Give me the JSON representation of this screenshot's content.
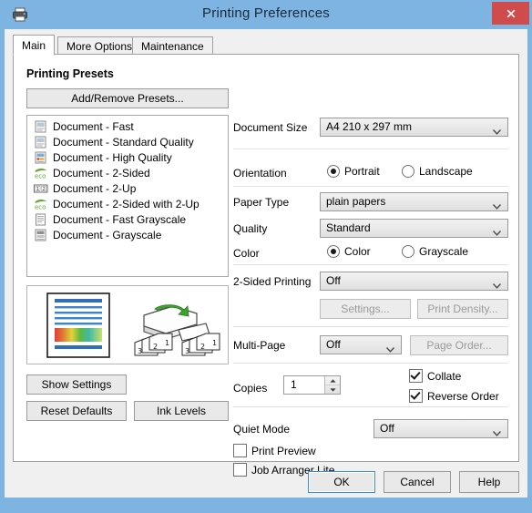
{
  "window": {
    "title": "Printing Preferences",
    "title_icon": "printer-icon",
    "close_label": "✕",
    "titlebar_color": "#7eb4e2",
    "close_color": "#d04c4c"
  },
  "tabs": [
    {
      "label": "Main",
      "active": true
    },
    {
      "label": "More Options",
      "active": false
    },
    {
      "label": "Maintenance",
      "active": false
    }
  ],
  "presets": {
    "heading": "Printing Presets",
    "add_remove_label": "Add/Remove Presets...",
    "items": [
      {
        "label": "Document - Fast",
        "icon": "document-icon"
      },
      {
        "label": "Document - Standard Quality",
        "icon": "document-icon"
      },
      {
        "label": "Document - High Quality",
        "icon": "document-color-icon"
      },
      {
        "label": "Document - 2-Sided",
        "icon": "eco-icon"
      },
      {
        "label": "Document - 2-Up",
        "icon": "two-up-icon"
      },
      {
        "label": "Document - 2-Sided with 2-Up",
        "icon": "eco-icon"
      },
      {
        "label": "Document - Fast Grayscale",
        "icon": "document-gray-icon"
      },
      {
        "label": "Document - Grayscale",
        "icon": "document-gray-dark-icon"
      }
    ]
  },
  "preview": {
    "page_icon": "page-preview-icon",
    "printer_icon": "printer-duplex-icon",
    "stack_labels": [
      "3",
      "2",
      "1"
    ]
  },
  "left_buttons": {
    "show_settings": "Show Settings",
    "reset_defaults": "Reset Defaults",
    "ink_levels": "Ink Levels"
  },
  "settings": {
    "document_size": {
      "label": "Document Size",
      "value": "A4 210 x 297 mm"
    },
    "orientation": {
      "label": "Orientation",
      "options": [
        "Portrait",
        "Landscape"
      ],
      "selected": "Portrait"
    },
    "paper_type": {
      "label": "Paper Type",
      "value": "plain papers"
    },
    "quality": {
      "label": "Quality",
      "value": "Standard"
    },
    "color": {
      "label": "Color",
      "options": [
        "Color",
        "Grayscale"
      ],
      "selected": "Color"
    },
    "two_sided": {
      "label": "2-Sided Printing",
      "value": "Off",
      "settings_button": "Settings...",
      "print_density_button": "Print Density..."
    },
    "multi_page": {
      "label": "Multi-Page",
      "value": "Off",
      "page_order_button": "Page Order..."
    },
    "copies": {
      "label": "Copies",
      "value": "1",
      "collate": {
        "label": "Collate",
        "checked": true
      },
      "reverse_order": {
        "label": "Reverse Order",
        "checked": true
      }
    },
    "quiet_mode": {
      "label": "Quiet Mode",
      "value": "Off"
    },
    "print_preview": {
      "label": "Print Preview",
      "checked": false
    },
    "job_arranger": {
      "label": "Job Arranger Lite",
      "checked": false
    }
  },
  "dialog_buttons": {
    "ok": "OK",
    "cancel": "Cancel",
    "help": "Help"
  }
}
